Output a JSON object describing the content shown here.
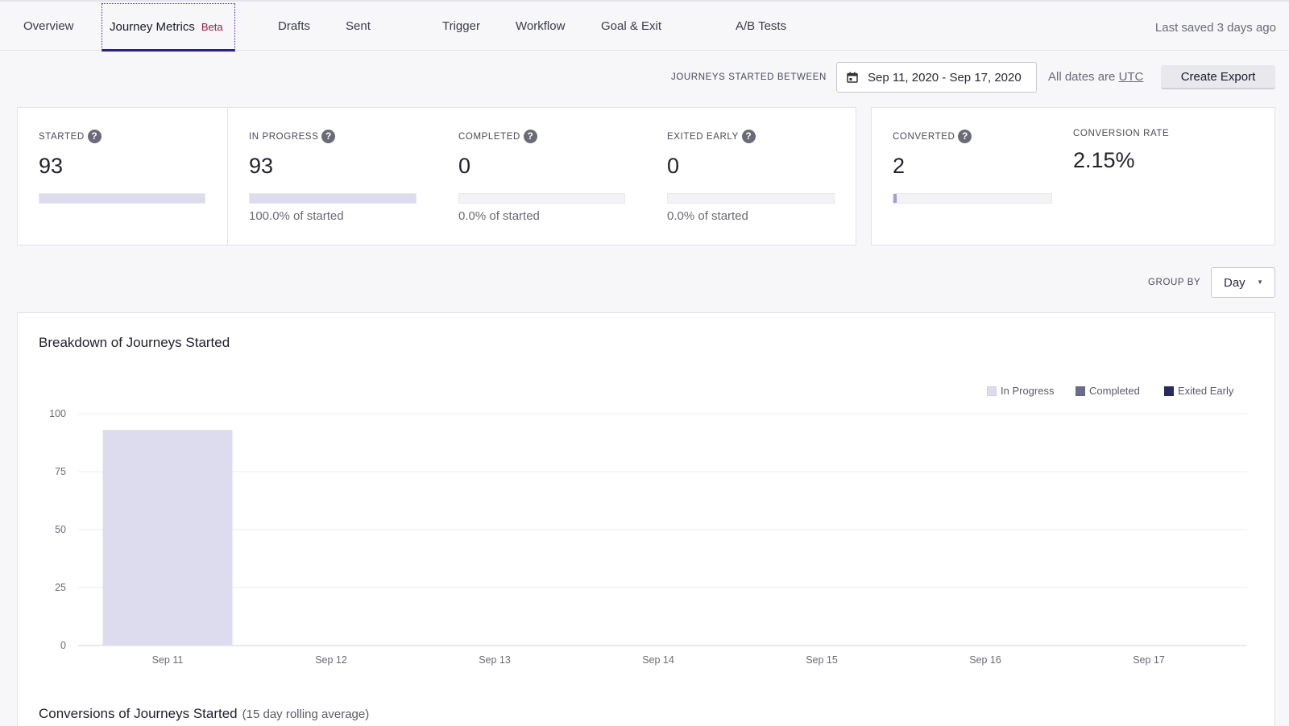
{
  "nav": {
    "tabs": [
      {
        "label": "Overview"
      },
      {
        "label": "Journey Metrics",
        "badge": "Beta",
        "active": true
      },
      {
        "label": "Drafts"
      },
      {
        "label": "Sent"
      },
      {
        "label": "Trigger"
      },
      {
        "label": "Workflow"
      },
      {
        "label": "Goal & Exit"
      },
      {
        "label": "A/B Tests"
      }
    ],
    "last_saved": "Last saved 3 days ago"
  },
  "export": {
    "range_label": "JOURNEYS STARTED BETWEEN",
    "date_range": "Sep 11, 2020 - Sep 17, 2020",
    "utc_prefix": "All dates are",
    "utc_link": "UTC",
    "button_label": "Create Export"
  },
  "stats": {
    "started": {
      "label": "STARTED",
      "value": "93",
      "bar_fraction": 1.0
    },
    "in_progress": {
      "label": "IN PROGRESS",
      "value": "93",
      "pct_text": "100.0% of started",
      "bar_fraction": 1.0
    },
    "completed": {
      "label": "COMPLETED",
      "value": "0",
      "pct_text": "0.0% of started",
      "bar_fraction": 0.0
    },
    "exited_early": {
      "label": "EXITED EARLY",
      "value": "0",
      "pct_text": "0.0% of started",
      "bar_fraction": 0.0
    },
    "converted": {
      "label": "CONVERTED",
      "value": "2",
      "bar_fraction": 0.0215
    },
    "conversion_rate": {
      "label": "CONVERSION RATE",
      "value": "2.15%"
    }
  },
  "group_by": {
    "label": "GROUP BY",
    "value": "Day"
  },
  "colors": {
    "in_progress": "#dddcee",
    "completed": "#6b6b8c",
    "exited_early": "#2a2a62",
    "grid": "#ececf0"
  },
  "chart_title": "Breakdown of Journeys Started",
  "chart_data": {
    "type": "bar",
    "stacked": true,
    "categories": [
      "Sep 11",
      "Sep 12",
      "Sep 13",
      "Sep 14",
      "Sep 15",
      "Sep 16",
      "Sep 17"
    ],
    "series": [
      {
        "name": "In Progress",
        "values": [
          93,
          0,
          0,
          0,
          0,
          0,
          0
        ]
      },
      {
        "name": "Completed",
        "values": [
          0,
          0,
          0,
          0,
          0,
          0,
          0
        ]
      },
      {
        "name": "Exited Early",
        "values": [
          0,
          0,
          0,
          0,
          0,
          0,
          0
        ]
      }
    ],
    "yticks": [
      0,
      25,
      50,
      75,
      100
    ],
    "ylim": [
      0,
      100
    ],
    "grid": true,
    "legend": "top-right"
  },
  "conversions": {
    "title": "Conversions of Journeys Started",
    "subtitle": "(15 day rolling average)"
  }
}
